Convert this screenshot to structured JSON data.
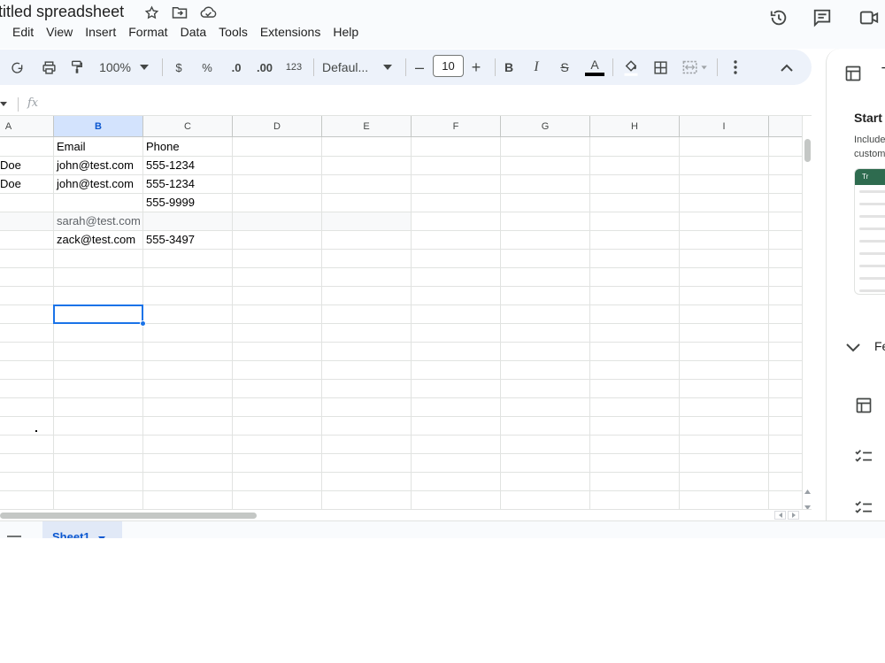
{
  "title": {
    "doc_title": "titled spreadsheet"
  },
  "menu": [
    "Edit",
    "View",
    "Insert",
    "Format",
    "Data",
    "Tools",
    "Extensions",
    "Help"
  ],
  "toolbar": {
    "zoom": "100%",
    "currency": "$",
    "percent": "%",
    "decrease_decimal": ".0",
    "increase_decimal": ".00",
    "number_format": "123",
    "font": "Defaul...",
    "font_size": "10",
    "minus": "–",
    "plus": "+",
    "bold": "B",
    "italic": "I",
    "strikethrough": "S",
    "text_color": "A"
  },
  "formula_bar": {
    "fx": "fx"
  },
  "grid": {
    "columns": [
      "A",
      "B",
      "C",
      "D",
      "E",
      "F",
      "G",
      "H",
      "I"
    ],
    "selected_column": "B",
    "rows": [
      {
        "a": "",
        "b": "Email",
        "c": "Phone"
      },
      {
        "a": "Doe",
        "b": "john@test.com",
        "c": "555-1234"
      },
      {
        "a": "Doe",
        "b": "john@test.com",
        "c": "555-1234"
      },
      {
        "a": "",
        "b": "",
        "c": "555-9999"
      },
      {
        "a": "",
        "b": "sarah@test.com",
        "c": ""
      },
      {
        "a": "",
        "b": "zack@test.com",
        "c": "555-3497"
      }
    ]
  },
  "sheets": {
    "active": "Sheet1"
  },
  "side_panel": {
    "title": "Start",
    "subtitle_line1": "Include",
    "subtitle_line2": "custom",
    "template_label": "Tr",
    "section_label": "Fe",
    "header_label": "T"
  },
  "colors": {
    "accent": "#1a73e8",
    "toolbar_bg": "#edf2fa",
    "selected_header": "#d3e3fd",
    "template_green": "#2e6b4f"
  }
}
